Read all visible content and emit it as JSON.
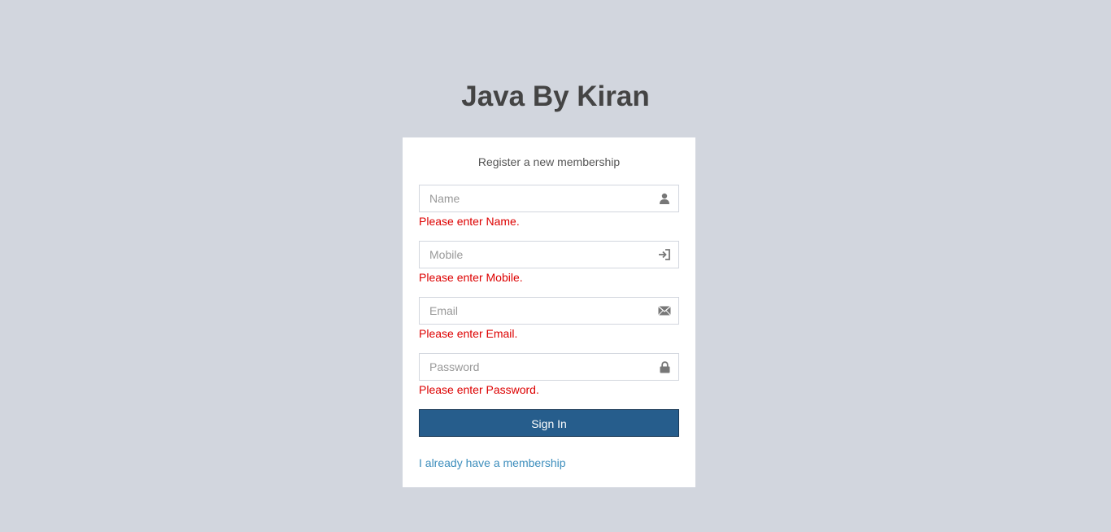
{
  "logo": {
    "title": "Java By Kiran"
  },
  "form": {
    "message": "Register a new membership",
    "fields": [
      {
        "placeholder": "Name",
        "value": "",
        "icon": "user-icon",
        "error": "Please enter Name."
      },
      {
        "placeholder": "Mobile",
        "value": "",
        "icon": "log-in-icon",
        "error": "Please enter Mobile."
      },
      {
        "placeholder": "Email",
        "value": "",
        "icon": "envelope-icon",
        "error": "Please enter Email."
      },
      {
        "placeholder": "Password",
        "value": "",
        "icon": "lock-icon",
        "error": "Please enter Password."
      }
    ],
    "submit_label": "Sign In",
    "login_link": "I already have a membership"
  },
  "colors": {
    "background": "#d2d6de",
    "button": "#265d8c",
    "error": "#dd0000",
    "link": "#3c8dbc"
  }
}
